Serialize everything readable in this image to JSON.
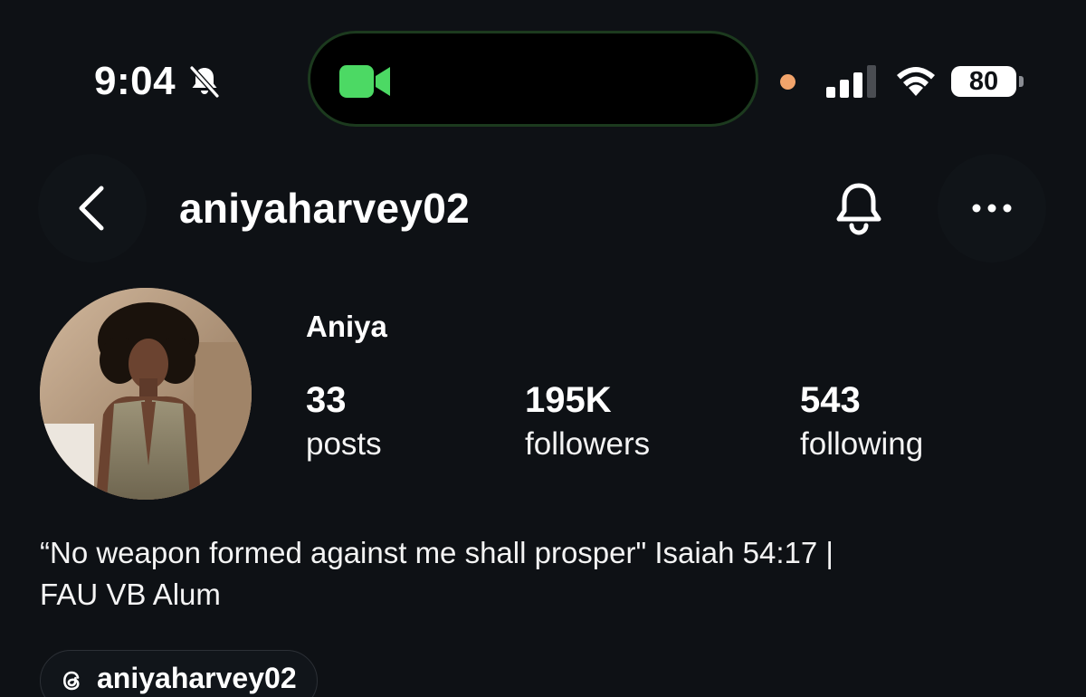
{
  "status_bar": {
    "time": "9:04",
    "battery_level": "80",
    "icons": [
      "bell-slash-icon",
      "facetime-camera-icon",
      "recording-dot",
      "signal-icon",
      "wifi-icon",
      "battery-icon"
    ],
    "colors": {
      "facetime": "#4cd964",
      "recording_dot": "#f2a46b"
    }
  },
  "header": {
    "username": "aniyaharvey02",
    "icons": [
      "chevron-left-icon",
      "bell-icon",
      "more-icon"
    ]
  },
  "profile": {
    "display_name": "Aniya",
    "stats": [
      {
        "value": "33",
        "label": "posts"
      },
      {
        "value": "195K",
        "label": "followers"
      },
      {
        "value": "543",
        "label": "following"
      }
    ],
    "bio_lines": [
      "“No weapon formed against me shall prosper\" Isaiah 54:17 |",
      "FAU VB Alum"
    ],
    "threads_link": "aniyaharvey02"
  }
}
